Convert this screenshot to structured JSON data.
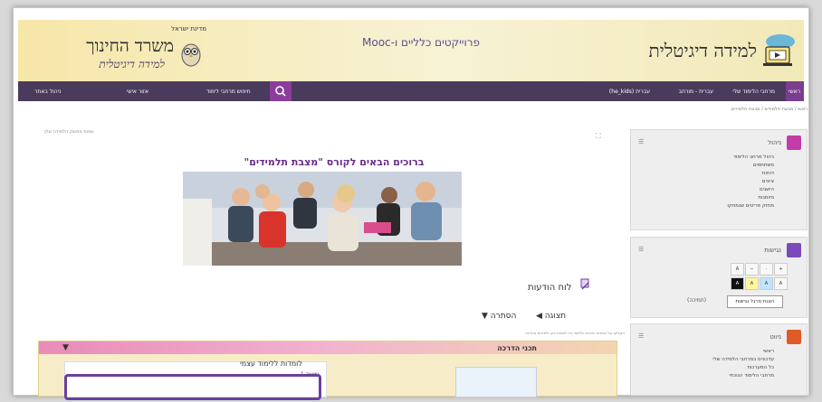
{
  "banner": {
    "ministry_top": "מדינת ישראל",
    "ministry_name": "משרד החינוך",
    "ministry_sub": "למידה דיגיטלית",
    "center_title": "פרוייקטים כלליים ו-Mooc",
    "digital_learning": "למידה דיגיטלית"
  },
  "nav": {
    "home": "ראשי",
    "my_courses": "מרחבי הלימוד שלי",
    "switch_language": "עברית (he_kids)",
    "extras": "עברית - מורחב",
    "search_placeholder": "חיפוש מרחבי לימוד",
    "my_area": "אזור אישי",
    "login": "ניהול באתר"
  },
  "breadcrumb": "ראשי / מבצת תלמידים / מבצת תלמידים",
  "language_note": "שפות ממשק הלמידה שלך",
  "welcome_title": "ברוכים הבאים לקורס \"מצבת תלמידים\"",
  "news_label": "לוח הודעות",
  "controls": {
    "display": "תצוגה",
    "hide": "הסתרה"
  },
  "help_text": "הקליקו על כותרות יחידות הלימוד כדי לצפות בהן ולמודים אחרים.",
  "course": {
    "guide_label": "תכני הדרכה",
    "selfstudy_label": "לומדות ללימוד עצמי",
    "item_label": "שיעור 1"
  },
  "blocks": {
    "admin": {
      "title": "ניהול",
      "items": [
        "ניהול מרחב הלימוד",
        "משתתפים",
        "דוחות",
        "ציונים",
        "הישגים",
        "מיומנות",
        "מחזק פריטים שנמחקו"
      ]
    },
    "accessibility": {
      "title": "נגישות",
      "button": "הצגת סרגל נגישות",
      "user_note": "(תמיכה)"
    },
    "nav": {
      "title": "ניווט",
      "items": [
        "ראשי",
        "עדכונים במרחבי הלמידה שלי",
        "כל המערכות",
        "מרחבי הלימוד הנוכחי"
      ]
    }
  },
  "colors": {
    "nav_bg": "#4a3b5c",
    "accent_purple": "#7a3d8f",
    "highlight": "#6a3fa0",
    "welcome_text": "#6a2b8c"
  }
}
